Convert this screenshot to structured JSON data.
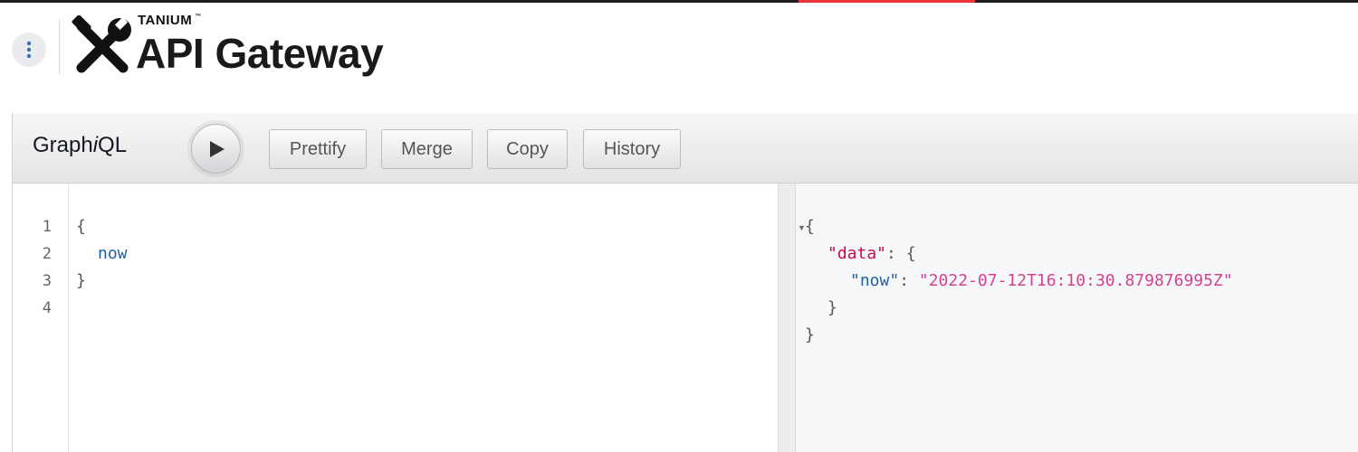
{
  "header": {
    "brand": "TANIUM",
    "trademark": "™",
    "title": "API Gateway"
  },
  "toolbar": {
    "title_prefix": "Graph",
    "title_italic": "i",
    "title_suffix": "QL",
    "execute_icon": "play-icon",
    "buttons": {
      "prettify": "Prettify",
      "merge": "Merge",
      "copy": "Copy",
      "history": "History"
    }
  },
  "query_editor": {
    "line_numbers": [
      "1",
      "2",
      "3",
      "4"
    ],
    "lines": [
      "{",
      "now",
      "}",
      ""
    ]
  },
  "results": {
    "open_brace": "{",
    "data_key": "\"data\"",
    "colon_brace": ": {",
    "now_key": "\"now\"",
    "colon": ": ",
    "now_value": "\"2022-07-12T16:10:30.879876995Z\"",
    "inner_close": "}",
    "outer_close": "}"
  },
  "colors": {
    "accent": "#e8363c",
    "field": "#1f61a0",
    "key": "#d2054e",
    "string": "#d64292"
  }
}
